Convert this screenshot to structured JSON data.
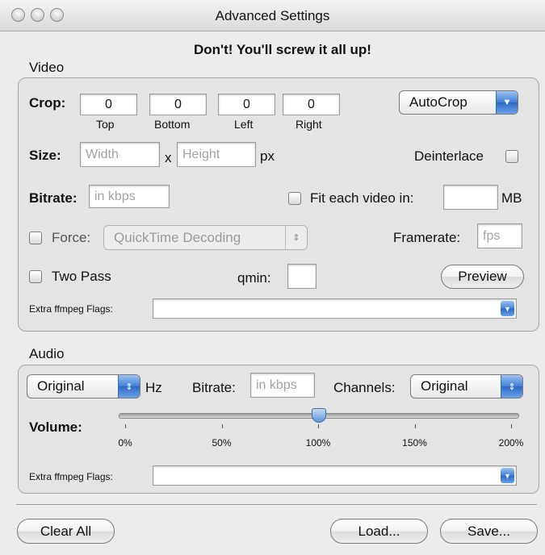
{
  "window": {
    "title": "Advanced Settings"
  },
  "warning": "Don't! You'll screw it all up!",
  "video": {
    "section_label": "Video",
    "crop": {
      "label": "Crop:",
      "fields": [
        {
          "value": "0",
          "label": "Top"
        },
        {
          "value": "0",
          "label": "Bottom"
        },
        {
          "value": "0",
          "label": "Left"
        },
        {
          "value": "0",
          "label": "Right"
        }
      ],
      "autocrop": "AutoCrop"
    },
    "size": {
      "label": "Size:",
      "width_placeholder": "Width",
      "separator": "x",
      "height_placeholder": "Height",
      "unit": "px"
    },
    "deinterlace": {
      "label": "Deinterlace",
      "checked": false
    },
    "bitrate": {
      "label": "Bitrate:",
      "placeholder": "in kbps"
    },
    "fit": {
      "label": "Fit each video in:",
      "value": "",
      "unit": "MB",
      "checked": false
    },
    "force": {
      "label": "Force:",
      "selected": "QuickTime Decoding",
      "checked": false
    },
    "framerate": {
      "label": "Framerate:",
      "placeholder": "fps"
    },
    "two_pass": {
      "label": "Two Pass",
      "checked": false
    },
    "qmin": {
      "label": "qmin:",
      "value": ""
    },
    "preview": "Preview",
    "extra_flags": {
      "label": "Extra ffmpeg Flags:",
      "value": ""
    }
  },
  "audio": {
    "section_label": "Audio",
    "samplerate": {
      "selected": "Original",
      "unit": "Hz"
    },
    "bitrate": {
      "label": "Bitrate:",
      "placeholder": "in kbps"
    },
    "channels": {
      "label": "Channels:",
      "selected": "Original"
    },
    "volume": {
      "label": "Volume:",
      "value_percent": 100,
      "ticks": [
        "0%",
        "50%",
        "100%",
        "150%",
        "200%"
      ]
    },
    "extra_flags": {
      "label": "Extra ffmpeg Flags:",
      "value": ""
    }
  },
  "buttons": {
    "clear_all": "Clear All",
    "load": "Load...",
    "save": "Save..."
  },
  "colors": {
    "accent_blue": "#3f7fd6",
    "window_bg": "#ececec",
    "group_bg": "#e4e4e4"
  },
  "icons": {
    "popup_arrow": "triangle-down",
    "stepper": "up-down-arrows"
  }
}
